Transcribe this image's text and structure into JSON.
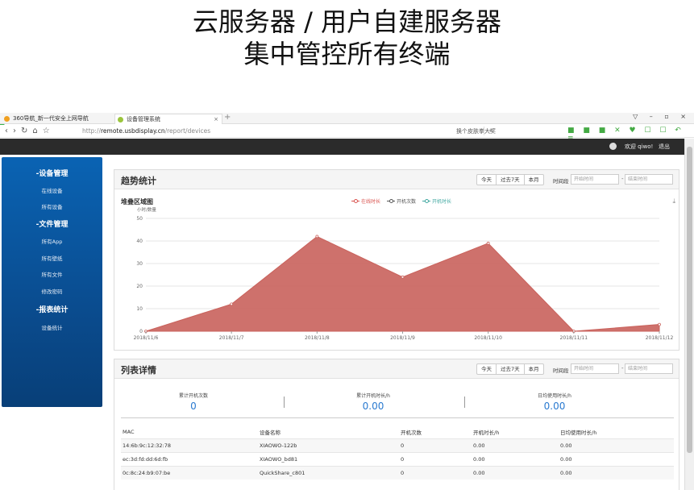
{
  "headline": {
    "line1": "云服务器 / 用户自建服务器",
    "line2": "集中管控所有终端"
  },
  "browser": {
    "tabs": [
      {
        "label": "360导航_新一代安全上网导航",
        "icon": "360-logo-icon",
        "active": false
      },
      {
        "label": "设备管理系统",
        "icon": "leaf-icon",
        "active": true
      }
    ],
    "url_scheme": "http://",
    "url_domain": "remote.usbdisplay.cn",
    "url_path": "/report/devices",
    "skin_text": "换个皮肤拳大奖",
    "window_controls": "▽ – ▫ ×"
  },
  "app": {
    "user_label": "欢迎 qiwo!",
    "logout_label": "退出"
  },
  "sidebar": {
    "sections": [
      {
        "title": "-设备管理",
        "items": [
          "在线设备",
          "所有设备"
        ]
      },
      {
        "title": "-文件管理",
        "items": [
          "所有App",
          "所有壁纸",
          "所有文件",
          "修改密码"
        ]
      },
      {
        "title": "-报表统计",
        "items": [
          "设备统计"
        ]
      }
    ]
  },
  "trend": {
    "title": "趋势统计",
    "buttons": [
      "今天",
      "过去7天",
      "本月"
    ],
    "time_label": "时间段",
    "start_placeholder": "开始时间",
    "end_placeholder": "结束时间",
    "separator": "-"
  },
  "list": {
    "title": "列表详情",
    "buttons": [
      "今天",
      "过去7天",
      "本月"
    ],
    "time_label": "时间段",
    "start_placeholder": "开始时间",
    "end_placeholder": "结束时间",
    "separator": "-",
    "summary": [
      {
        "label": "累计开机次数",
        "value": "0"
      },
      {
        "label": "累计开机时长/h",
        "value": "0.00"
      },
      {
        "label": "日均使用时长/h",
        "value": "0.00"
      }
    ],
    "columns": [
      "MAC",
      "设备名称",
      "开机次数",
      "开机时长/h",
      "日均使用时长/h"
    ],
    "rows": [
      [
        "14:6b:9c:12:32:78",
        "XIAOWO-122b",
        "0",
        "0.00",
        "0.00"
      ],
      [
        "ec:3d:fd:dd:6d:fb",
        "XIAOWO_bd81",
        "0",
        "0.00",
        "0.00"
      ],
      [
        "0c:8c:24:b9:07:be",
        "QuickShare_c801",
        "0",
        "0.00",
        "0.00"
      ]
    ]
  },
  "chart_data": {
    "type": "area",
    "title": "堆叠区域图",
    "ylabel": "小时/数量",
    "legend": [
      "在线时长",
      "开机次数",
      "开机时长"
    ],
    "legend_colors": [
      "#d9534f",
      "#555555",
      "#3fa7a0"
    ],
    "legend_position": "top-center",
    "x": [
      "2018/11/6",
      "2018/11/7",
      "2018/11/8",
      "2018/11/9",
      "2018/11/10",
      "2018/11/11",
      "2018/11/12"
    ],
    "series": [
      {
        "name": "在线时长",
        "values": [
          0,
          12,
          42,
          24,
          39,
          0,
          3
        ],
        "color": "#c9625c"
      }
    ],
    "ylim": [
      0,
      50
    ],
    "yticks": [
      0,
      10,
      20,
      30,
      40,
      50
    ],
    "grid": true
  }
}
